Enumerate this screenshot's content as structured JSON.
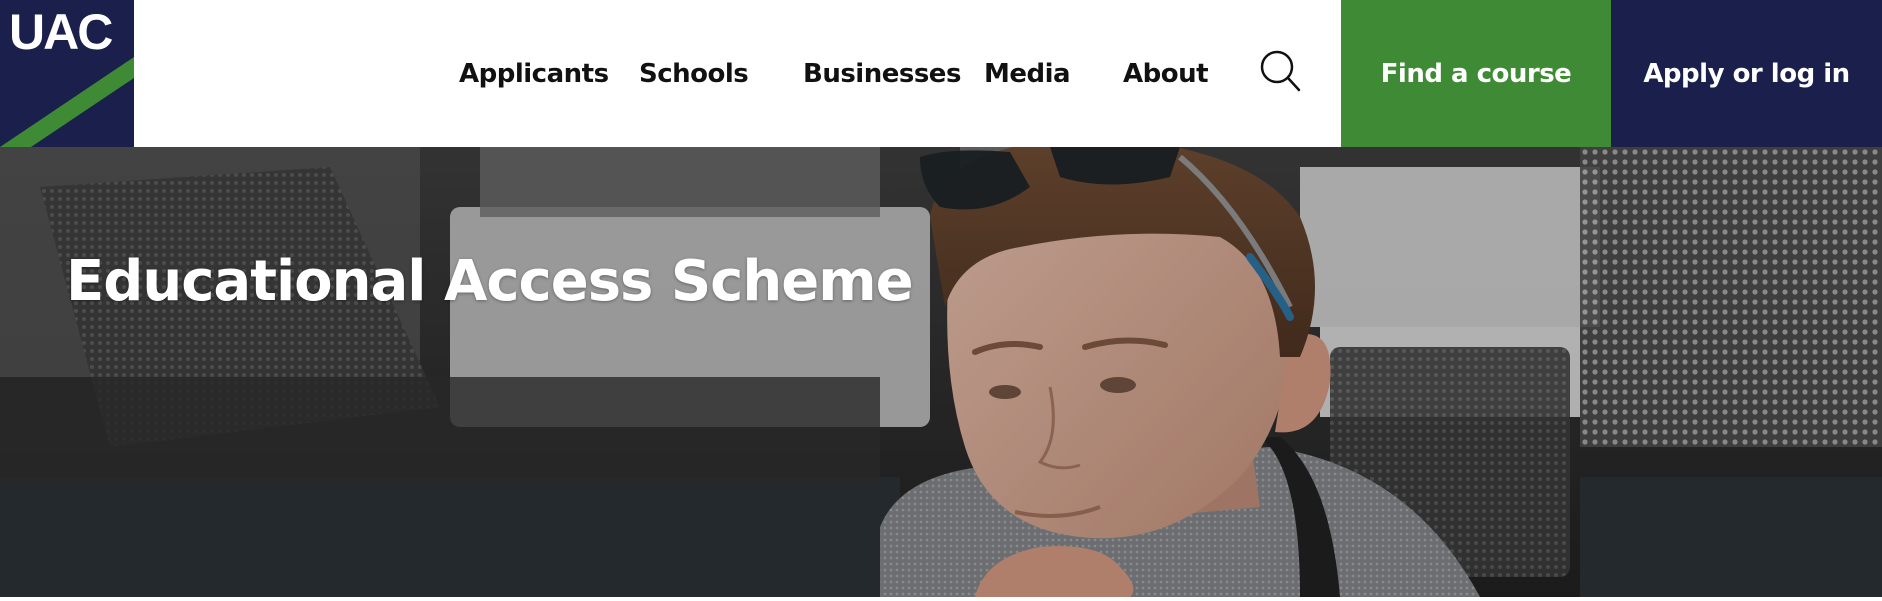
{
  "logo": {
    "text": "UAC",
    "colors": {
      "navy": "#1b1f4b",
      "green": "#3f8a35"
    }
  },
  "nav": {
    "items": [
      {
        "label": "Applicants"
      },
      {
        "label": "Schools"
      },
      {
        "label": "Businesses"
      },
      {
        "label": "Media"
      },
      {
        "label": "About"
      }
    ],
    "search_icon": "search-icon"
  },
  "cta": {
    "find_course": "Find a course",
    "apply_login": "Apply or log in"
  },
  "hero": {
    "title": "Educational Access Scheme",
    "image": "student-at-computer-photo"
  },
  "colors": {
    "accent_green": "#3f8a35",
    "brand_navy": "#1b1f4b",
    "text_dark": "#111111"
  }
}
